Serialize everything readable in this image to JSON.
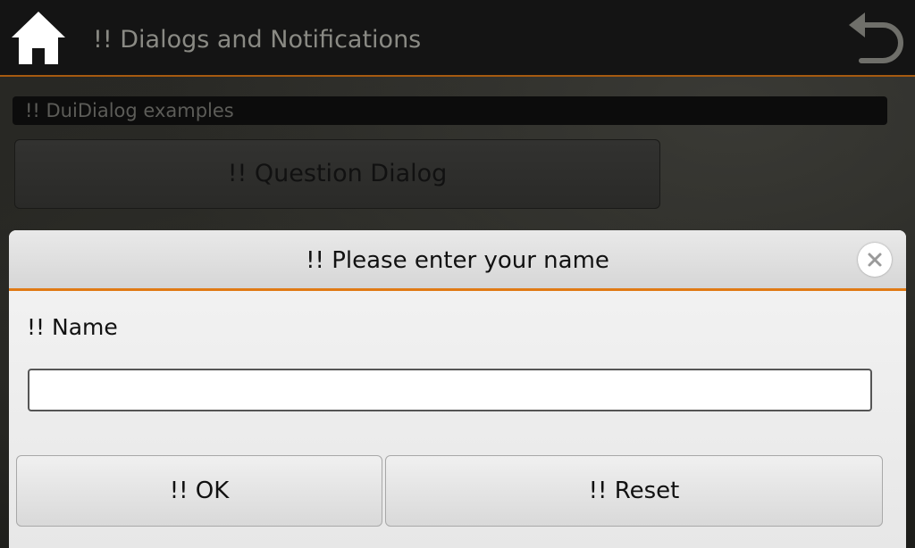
{
  "app": {
    "title": "!! Dialogs and Notifications"
  },
  "icons": {
    "home": "home-icon",
    "back": "back-arrow-icon",
    "close": "close-icon"
  },
  "section": {
    "header": "!!   DuiDialog examples",
    "question_button": "!! Question Dialog"
  },
  "dialog": {
    "title": "!! Please enter your name",
    "name_label": "!! Name",
    "name_value": "",
    "ok_label": "!! OK",
    "reset_label": "!! Reset"
  },
  "colors": {
    "accent": "#e07a14",
    "titlebar": "#141414",
    "dialog_bg": "#eeeeee"
  }
}
